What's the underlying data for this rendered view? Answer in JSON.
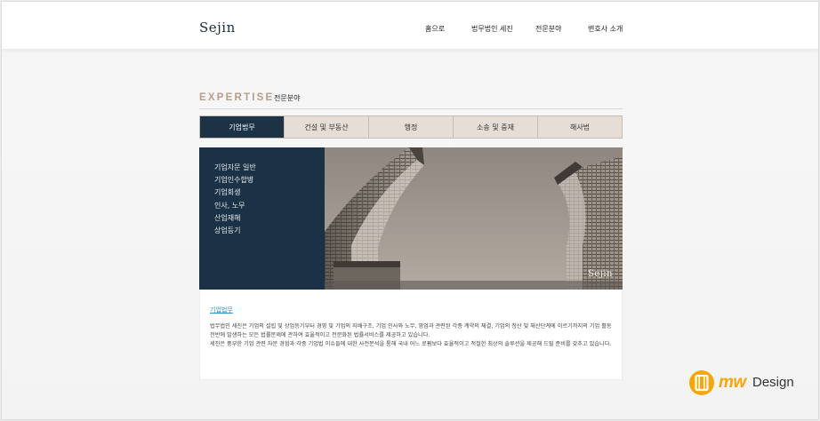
{
  "header": {
    "logo": "Sejin",
    "nav": [
      {
        "label": "홈으로"
      },
      {
        "label": "법무법인 세진"
      },
      {
        "label": "전문분야"
      },
      {
        "label": "변호사 소개"
      }
    ]
  },
  "section": {
    "eyebrow": "EXPERTISE",
    "title": "전문분야"
  },
  "tabs": [
    {
      "label": "기업법무",
      "active": true
    },
    {
      "label": "건설 및 부동산",
      "active": false
    },
    {
      "label": "행정",
      "active": false
    },
    {
      "label": "소송 및 중재",
      "active": false
    },
    {
      "label": "해사법",
      "active": false
    }
  ],
  "submenu": [
    {
      "label": "기업자문 일반"
    },
    {
      "label": "기업인수합병"
    },
    {
      "label": "기업회생"
    },
    {
      "label": "인사, 노무"
    },
    {
      "label": "산업재해"
    },
    {
      "label": "상업등기"
    }
  ],
  "photo": {
    "watermark": "Sejin"
  },
  "description": {
    "heading": "기업법무",
    "paragraphs": [
      "법무법인 세진은 기업의 설립 및 상업등기부터 경영 및 기업의 지배구조, 기업 인사와 노무, 영업과 관련된 각종 계약의 체결, 기업의 청산 및 해산단계에 이르기까지의 기업 활동 전반에 발생하는 모든 법률문제에 관하여 효율적이고 전문화된 법률서비스를 제공하고 있습니다.",
      "세진은 풍부한 기업 관련 자문 경험과 각종 기업법 이슈들에 대한 사전분석을 통해 국내 어느 로펌보다 효율적이고 적절한 최상의 솔루션을 제공해 드릴 준비를 갖추고 있습니다."
    ]
  },
  "brand": {
    "mw": "mw",
    "design": "Design"
  },
  "colors": {
    "navy": "#1c3245",
    "tab_bg": "#e6ddd6",
    "eyebrow": "#b79d8a",
    "link": "#2a8fc7",
    "brand_orange": "#f5a60a"
  }
}
